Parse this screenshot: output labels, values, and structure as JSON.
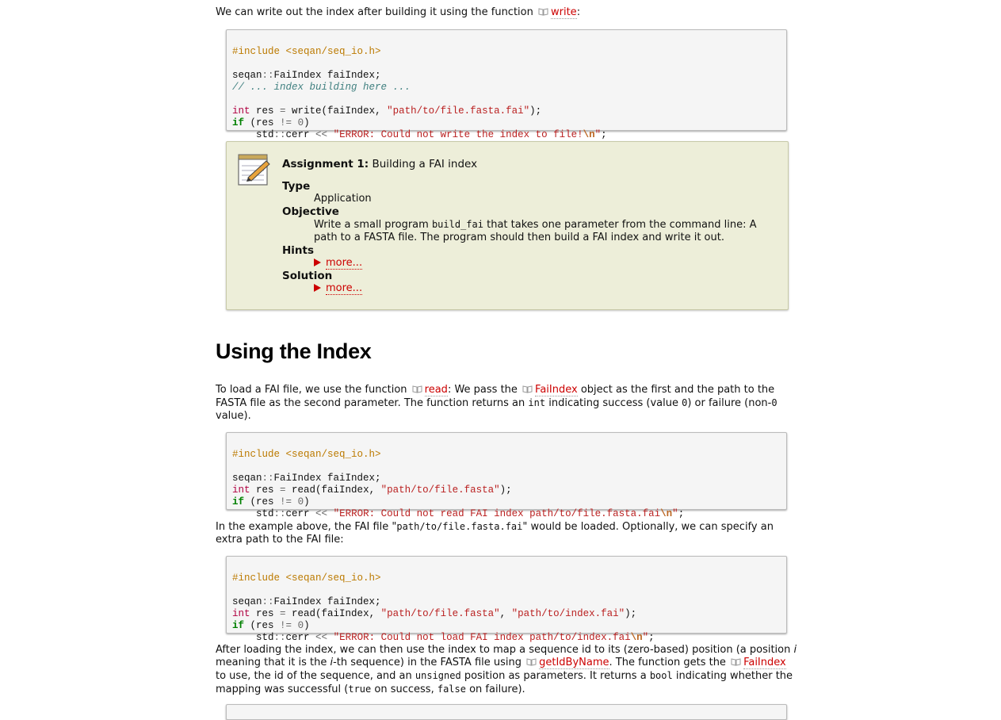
{
  "intro": {
    "text_before": "We can write out the index after building it using the function ",
    "link": "write",
    "text_after": ":"
  },
  "code1": [
    "#include <seqan/seq_io.h>",
    "",
    "seqan::FaiIndex faiIndex;",
    "// ... index building here ...",
    "",
    "int res = write(faiIndex, \"path/to/file.fasta.fai\");",
    "if (res != 0)",
    "    std::cerr << \"ERROR: Could not write the index to file!\\n\";"
  ],
  "assignment": {
    "title_bold": "Assignment 1:",
    "title_rest": " Building a FAI index",
    "type_label": "Type",
    "type_value": "Application",
    "objective_label": "Objective",
    "objective_pre": "Write a small program ",
    "objective_code": "build_fai",
    "objective_post": " that takes one parameter from the command line: A path to a FASTA file. The program should then build a FAI index and write it out.",
    "hints_label": "Hints",
    "hints_more": "more...",
    "solution_label": "Solution",
    "solution_more": "more..."
  },
  "section_heading": "Using the Index",
  "para2": {
    "t1": "To load a FAI file, we use the function ",
    "link1": "read",
    "t2": ": We pass the ",
    "link2": "FaiIndex",
    "t3": " object as the first and the path to the FASTA file as the second parameter. The function returns an ",
    "c1": "int",
    "t4": " indicating success (value ",
    "c2": "0",
    "t5": ") or failure (non-",
    "c3": "0",
    "t6": " value)."
  },
  "code2": [
    "#include <seqan/seq_io.h>",
    "",
    "seqan::FaiIndex faiIndex;",
    "int res = read(faiIndex, \"path/to/file.fasta\");",
    "if (res != 0)",
    "    std::cerr << \"ERROR: Could not read FAI index path/to/file.fasta.fai\\n\";"
  ],
  "para3": {
    "t1": "In the example above, the FAI file \"",
    "c1": "path/to/file.fasta.fai",
    "t2": "\" would be loaded. Optionally, we can specify an extra path to the FAI file:"
  },
  "code3": [
    "#include <seqan/seq_io.h>",
    "",
    "seqan::FaiIndex faiIndex;",
    "int res = read(faiIndex, \"path/to/file.fasta\", \"path/to/index.fai\");",
    "if (res != 0)",
    "    std::cerr << \"ERROR: Could not load FAI index path/to/index.fai\\n\";"
  ],
  "para4": {
    "t1": "After loading the index, we can then use the index to map a sequence id to its (zero-based) position (a position ",
    "i1": "i",
    "t2": " meaning that it is the ",
    "i2": "i",
    "t3": "-th sequence) in the FASTA file using ",
    "link1": "getIdByName",
    "t4": ". The function gets the ",
    "link2": "FaiIndex",
    "t5": " to use, the id of the sequence, and an ",
    "c1": "unsigned",
    "t6": " position as parameters. It returns a ",
    "c2": "bool",
    "t7": " indicating whether the mapping was successful (",
    "c3": "true",
    "t8": " on success, ",
    "c4": "false",
    "t9": " on failure)."
  },
  "icons": {
    "api_link": "book-icon",
    "assignment": "notepad-pencil-icon",
    "expand": "triangle-right-icon"
  },
  "colors": {
    "link": "#cc0000",
    "assignment_bg": "#edeed9",
    "code_bg": "#f5f5f5"
  }
}
